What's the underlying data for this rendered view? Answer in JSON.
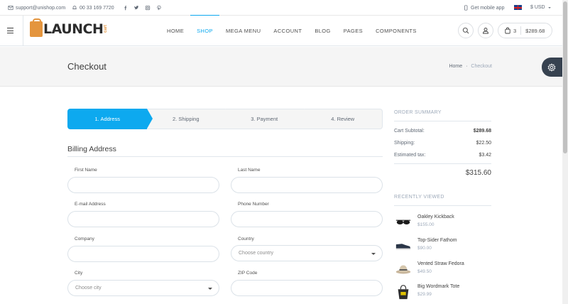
{
  "topbar": {
    "email": "support@unishop.com",
    "phone": "00 33 169 7720",
    "mobile_app": "Get mobile app",
    "currency": "$ USD"
  },
  "header": {
    "logo_text": "LAUNCH",
    "logo_sub": "cart",
    "nav": [
      "HOME",
      "SHOP",
      "MEGA MENU",
      "ACCOUNT",
      "BLOG",
      "PAGES",
      "COMPONENTS"
    ],
    "active_nav": "SHOP",
    "cart_count": "3",
    "cart_total": "$289.68"
  },
  "page": {
    "title": "Checkout",
    "breadcrumb_home": "Home",
    "breadcrumb_sep": "·",
    "breadcrumb_current": "Checkout"
  },
  "steps": [
    "1. Address",
    "2. Shipping",
    "3. Payment",
    "4. Review"
  ],
  "billing": {
    "title": "Billing Address",
    "first_name": "First Name",
    "last_name": "Last Name",
    "email": "E-mail Address",
    "phone": "Phone Number",
    "company": "Company",
    "country": "Country",
    "country_placeholder": "Choose country",
    "city": "City",
    "city_placeholder": "Choose city",
    "zip": "ZIP Code"
  },
  "summary": {
    "heading": "ORDER SUMMARY",
    "subtotal_label": "Cart Subtotal:",
    "subtotal": "$289.68",
    "shipping_label": "Shipping:",
    "shipping": "$22.50",
    "tax_label": "Estimated tax:",
    "tax": "$3.42",
    "total": "$315.60"
  },
  "recent": {
    "heading": "RECENTLY VIEWED",
    "items": [
      {
        "name": "Oakley Kickback",
        "price": "$155.00",
        "icon": "sunglasses-icon"
      },
      {
        "name": "Top-Sider Fathom",
        "price": "$90.00",
        "icon": "shoe-icon"
      },
      {
        "name": "Vented Straw Fedora",
        "price": "$49.50",
        "icon": "hat-icon"
      },
      {
        "name": "Big Wordmark Tote",
        "price": "$29.99",
        "icon": "bag-icon"
      }
    ]
  },
  "colors": {
    "accent": "#0da9ef",
    "brand_orange": "#e4953e",
    "dark": "#374250"
  }
}
